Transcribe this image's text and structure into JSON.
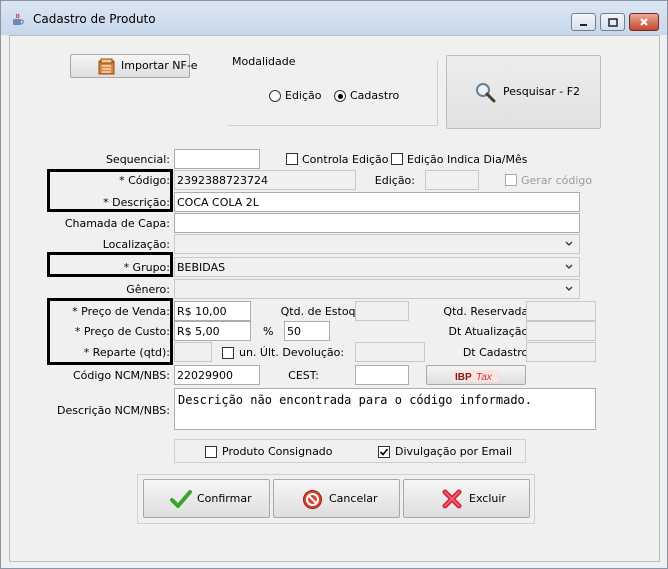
{
  "window": {
    "title": "Cadastro de Produto",
    "controls": [
      "minimize-icon",
      "maximize-icon",
      "close-icon"
    ]
  },
  "top": {
    "import_label": "Importar NF-e",
    "modalidade_label": "Modalidade",
    "radio_edicao": "Edição",
    "radio_cadastro": "Cadastro",
    "selected_modalidade": "Cadastro",
    "search_label": "Pesquisar - F2"
  },
  "form": {
    "sequencial_label": "Sequencial:",
    "sequencial_value": "",
    "controla_edicao_label": "Controla Edição",
    "controla_edicao_checked": false,
    "edicao_indica_label": "Edição Indica Dia/Mês",
    "edicao_indica_checked": false,
    "codigo_label": "* Código:",
    "codigo_value": "2392388723724",
    "edicao_label": "Edição:",
    "edicao_value": "",
    "gerar_codigo_label": "Gerar código",
    "gerar_codigo_checked": false,
    "descricao_label": "* Descrição:",
    "descricao_value": "COCA COLA 2L",
    "chamada_label": "Chamada de Capa:",
    "chamada_value": "",
    "localizacao_label": "Localização:",
    "localizacao_value": "",
    "grupo_label": "* Grupo:",
    "grupo_value": "BEBIDAS",
    "genero_label": "Gênero:",
    "genero_value": "",
    "preco_venda_label": "* Preço de Venda:",
    "preco_venda_value": "R$ 10,00",
    "qtd_estoque_label": "Qtd. de Estoque:",
    "qtd_estoque_value": "",
    "qtd_reservada_label": "Qtd. Reservada:",
    "qtd_reservada_value": "",
    "preco_custo_label": "* Preço de Custo:",
    "preco_custo_value": "R$ 5,00",
    "percent_label": "%",
    "percent_value": "50",
    "dt_atualizacao_label": "Dt Atualização:",
    "dt_atualizacao_value": "",
    "reparte_label": "* Reparte (qtd):",
    "reparte_value": "",
    "ult_devolucao_label": "un. Últ. Devolução:",
    "ult_devolucao_checked": false,
    "ult_devolucao_value": "",
    "dt_cadastro_label": "Dt Cadastro:",
    "dt_cadastro_value": "",
    "ncm_label": "Código NCM/NBS:",
    "ncm_value": "22029900",
    "cest_label": "CEST:",
    "cest_value": "",
    "ibptax_label": "IBPTax",
    "desc_ncm_label": "Descrição NCM/NBS:",
    "desc_ncm_value": "Descrição não encontrada para o código informado.",
    "consignado_label": "Produto Consignado",
    "consignado_checked": false,
    "divulgacao_label": "Divulgação por Email",
    "divulgacao_checked": true
  },
  "actions": {
    "confirmar": "Confirmar",
    "cancelar": "Cancelar",
    "excluir": "Excluir"
  },
  "colors": {
    "confirm_green": "#3aa629",
    "cancel_red": "#d8432e",
    "excluir_red": "#d8243c",
    "ibp_red": "#c0392b"
  }
}
